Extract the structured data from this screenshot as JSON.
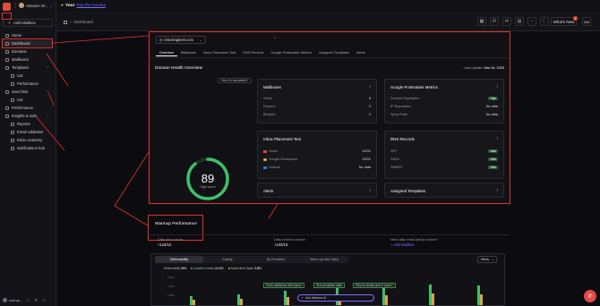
{
  "sidebar": {
    "account_name": "Akana's W...",
    "add_mailbox": "Add Mailbox",
    "items": [
      {
        "label": "Home"
      },
      {
        "label": "Dashboard"
      },
      {
        "label": "Domains"
      },
      {
        "label": "Mailboxes"
      },
      {
        "label": "Templates"
      },
      {
        "label": "List"
      },
      {
        "label": "Performance"
      },
      {
        "label": "Seed lists"
      },
      {
        "label": "List"
      },
      {
        "label": "Performance"
      },
      {
        "label": "Insights & tools"
      },
      {
        "label": "Reports"
      },
      {
        "label": "Email validation"
      },
      {
        "label": "Inbox academy"
      },
      {
        "label": "Notifications hub"
      }
    ],
    "footer_name": "warmy..."
  },
  "promo": {
    "bold": "Your",
    "link": "Pay the invoice"
  },
  "topbar": {
    "crumb": "Dashboard",
    "whats_new": "What's New",
    "badge": "1",
    "user_initials": "AM"
  },
  "domain": {
    "selected": "inboxingbest.com",
    "tabs": [
      "Overview",
      "Mailboxes",
      "Inbox Placement Test",
      "DNS Records",
      "Google Postmaster Metrics",
      "Assigned Templates",
      "Alerts"
    ],
    "section_title": "Domain Health Overview",
    "updated_label": "Last Update:",
    "updated_value": "Mar 04, 2025",
    "calc_pill": "How it's calculated?",
    "score": {
      "value": "89",
      "label": "High score",
      "fraction": 0.89
    },
    "mailboxes": {
      "title": "Mailboxes",
      "rows": [
        {
          "label": "Active",
          "value": "8"
        },
        {
          "label": "Paused",
          "value": "0"
        },
        {
          "label": "Blocked",
          "value": "0"
        }
      ]
    },
    "inbox_test": {
      "title": "Inbox Placement Test",
      "rows": [
        {
          "label": "Gmail",
          "value": "100%"
        },
        {
          "label": "Google Workspace",
          "value": "100%"
        },
        {
          "label": "Outlook",
          "value": "No data"
        }
      ]
    },
    "alerts": {
      "title": "Alerts"
    },
    "postmaster": {
      "title": "Google Postmaster Metrics",
      "rows": [
        {
          "label": "Domain Reputation",
          "value": "High"
        },
        {
          "label": "IP Reputation",
          "value": "No data"
        },
        {
          "label": "Spam Rate",
          "value": "No data"
        }
      ]
    },
    "dns": {
      "title": "DNS Records",
      "rows": [
        {
          "label": "SPF",
          "value": "Valid"
        },
        {
          "label": "DKIM",
          "value": "Valid"
        },
        {
          "label": "DMARC",
          "value": "Valid"
        }
      ]
    },
    "assigned_templates": {
      "title": "Assigned Templates"
    }
  },
  "warmup": {
    "title": "Warmup Performance",
    "sent_label": "Daily sent volume",
    "sent_value": "+124/12",
    "received_label": "Daily received volume",
    "received_value": "+132/13",
    "question": "Need daily email activity volume?",
    "add_mailbox": "+ Add Mailbox",
    "segments": [
      "Deliverability",
      "Activity",
      "By Providers",
      "Warm-up with clicks"
    ],
    "period": "Week",
    "legend": {
      "deliverability_label": "Deliverability",
      "deliverability_value": "96%",
      "inbox_label": "Landed in Inbox",
      "inbox_value": "24,402",
      "spam_label": "Saved from Spam",
      "spam_value": "3,891"
    },
    "yticks": [
      "3,000",
      "2,000",
      "1,000"
    ],
    "hints": [
      "Show mailboxes with issues",
      "Give templates stats",
      "Why do emails land in spam?"
    ],
    "ask": "Ask Addena AI"
  },
  "colors": {
    "accent": "#7c6cff",
    "danger": "#e03030",
    "success": "#3fbf6a",
    "brand": "#e24a3b"
  }
}
